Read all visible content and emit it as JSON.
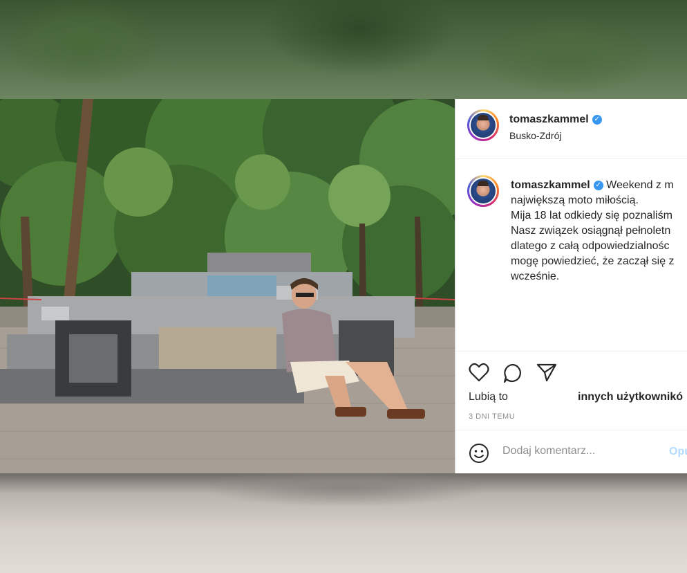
{
  "post": {
    "username": "tomaszkammel",
    "location": "Busko-Zdrój",
    "caption_lines": [
      "Weekend z m",
      "największą moto miłością.",
      "Mija 18 lat odkiedy się poznaliśm",
      "Nasz związek osiągnął pełnoletn",
      "dlatego z całą odpowiedzialnośc",
      "mogę powiedzieć, że zaczął się z",
      "wcześnie."
    ],
    "likes_prefix": "Lubią to",
    "likes_suffix": "innych użytkownikó",
    "timestamp": "3 DNI TEMU",
    "comment_placeholder": "Dodaj komentarz...",
    "post_label": "Opu"
  },
  "icons": {
    "verified": "verified-badge-icon",
    "like": "heart-icon",
    "comment": "comment-bubble-icon",
    "share": "paper-plane-icon",
    "emoji": "smiley-icon"
  },
  "colors": {
    "verified": "#3897f0",
    "post_button": "#b3dbff",
    "text": "#262626",
    "muted": "#8e8e8e"
  }
}
